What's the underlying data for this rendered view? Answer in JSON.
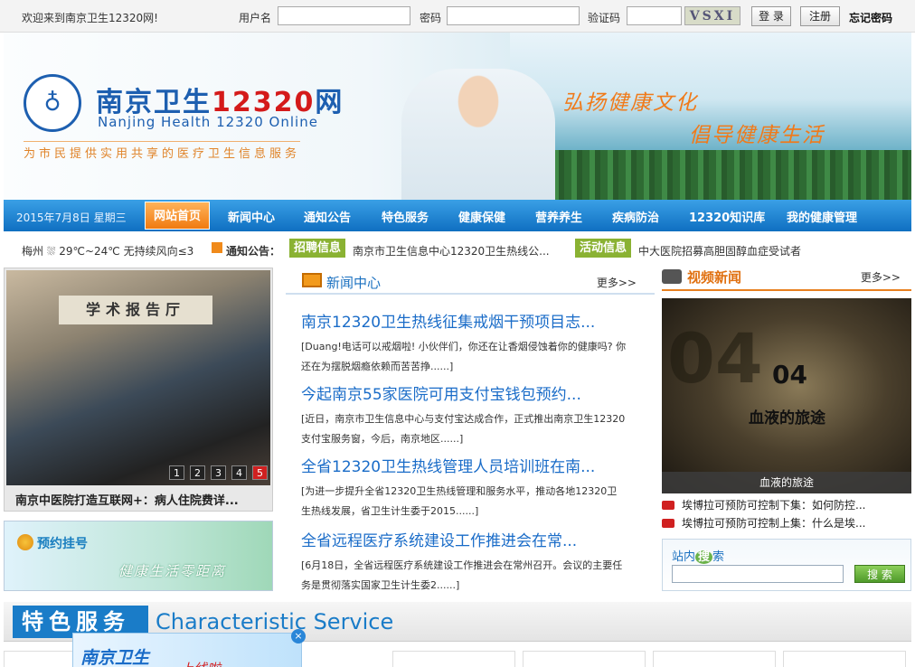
{
  "topbar": {
    "welcome": "欢迎来到南京卫生12320网!",
    "username_label": "用户名",
    "password_label": "密码",
    "captcha_label": "验证码",
    "captcha_text": "VSXI",
    "login": "登 录",
    "register": "注册",
    "forgot": "忘记密码"
  },
  "banner": {
    "logo_glyph": "♁",
    "site_name": "南京卫生",
    "site_num": "12320",
    "site_suffix": "网",
    "site_en": "Nanjing Health 12320 Online",
    "subtitle": "为市民提供实用共享的医疗卫生信息服务",
    "slogan1": "弘扬健康文化",
    "slogan2": "倡导健康生活"
  },
  "nav": {
    "date": "2015年7月8日 星期三",
    "home": "网站首页",
    "items": [
      "新闻中心",
      "通知公告",
      "特色服务",
      "健康保健",
      "营养养生",
      "疾病防治",
      "12320知识库",
      "我的健康管理"
    ]
  },
  "infobar": {
    "weather": "梅州 ⛆ 29℃~24℃ 无持续风向≤3",
    "notice_label": "通知公告：",
    "recruit_tag": "招聘信息",
    "recruit_text": "南京市卫生信息中心12320卫生热线公...",
    "activity_tag": "活动信息",
    "activity_text": "中大医院招募高胆固醇血症受试者"
  },
  "slide": {
    "board": "学术报告厅",
    "caption": "南京中医院打造互联网+：病人住院费详...",
    "dots": [
      "1",
      "2",
      "3",
      "4",
      "5"
    ]
  },
  "appt": {
    "title": "预约挂号",
    "tagline": "健康生活零距离"
  },
  "news": {
    "title": "新闻中心",
    "more": "更多>>",
    "items": [
      {
        "title": "南京12320卫生热线征集戒烟干预项目志...",
        "summary": "[Duang!电话可以戒烟啦! 小伙伴们，你还在让香烟侵蚀着你的健康吗? 你还在为摆脱烟瘾依赖而苦苦挣......]"
      },
      {
        "title": "今起南京55家医院可用支付宝钱包预约...",
        "summary": "[近日，南京市卫生信息中心与支付宝达成合作，正式推出南京卫生12320支付宝服务窗，今后，南京地区......]"
      },
      {
        "title": "全省12320卫生热线管理人员培训班在南...",
        "summary": "[为进一步提升全省12320卫生热线管理和服务水平，推动各地12320卫生热线发展，省卫生计生委于2015......]"
      },
      {
        "title": "全省远程医疗系统建设工作推进会在常...",
        "summary": "[6月18日，全省远程医疗系统建设工作推进会在常州召开。会议的主要任务是贯彻落实国家卫生计生委2......]"
      }
    ]
  },
  "video": {
    "title": "视频新闻",
    "more": "更多>>",
    "big_num": "04",
    "num": "04",
    "video_title": "血液的旅途",
    "bar_caption": "血液的旅途",
    "links": [
      "埃博拉可预防可控制下集：如何防控...",
      "埃博拉可预防可控制上集：什么是埃..."
    ]
  },
  "search": {
    "label_pre": "站内",
    "label_big": "搜",
    "label_post": "索",
    "button": "搜 索"
  },
  "feature": {
    "cn": "特色服务",
    "en": "Characteristic Service"
  },
  "floatad": {
    "t1": "南京卫生",
    "t2": "上线啦",
    "close": "×"
  }
}
